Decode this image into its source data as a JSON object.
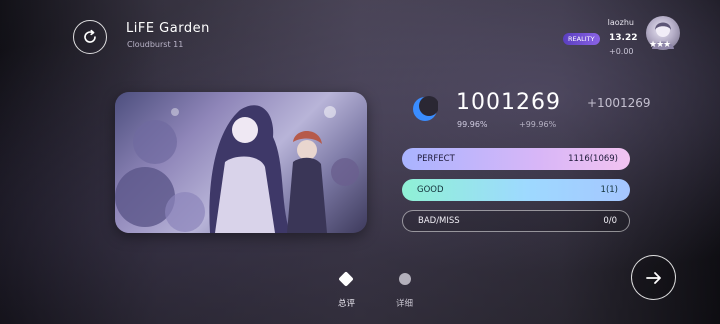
{
  "song": {
    "title": "LiFE Garden",
    "level": "Cloudburst 11"
  },
  "player": {
    "name": "laozhu",
    "rank_badge": "REALITY",
    "rks": "13.22",
    "rks_delta": "+0.00"
  },
  "result": {
    "score": "1001269",
    "score_delta": "+1001269",
    "accuracy": "99.96%",
    "accuracy_delta": "+99.96%",
    "judgements": [
      {
        "label": "PERFECT",
        "value": "1116(1069)"
      },
      {
        "label": "GOOD",
        "value": "1(1)"
      },
      {
        "label": "BAD/MISS",
        "value": "0/0"
      }
    ]
  },
  "tabs": [
    {
      "label": "总评",
      "icon": "diamond-icon",
      "active": true
    },
    {
      "label": "详细",
      "icon": "dot-icon",
      "active": false
    }
  ],
  "colors": {
    "perfect_gradient": [
      "#a9b4ff",
      "#f2c3f1"
    ],
    "good_gradient": [
      "#8ff1d5",
      "#a5c6ff"
    ],
    "grade_icon": "#3a8dff",
    "rank_badge": "#7a55dd"
  },
  "icons": {
    "retry": "retry-icon",
    "next": "arrow-right-icon",
    "grade": "crescent-grade-icon",
    "avatar_stars": "star-icon"
  }
}
